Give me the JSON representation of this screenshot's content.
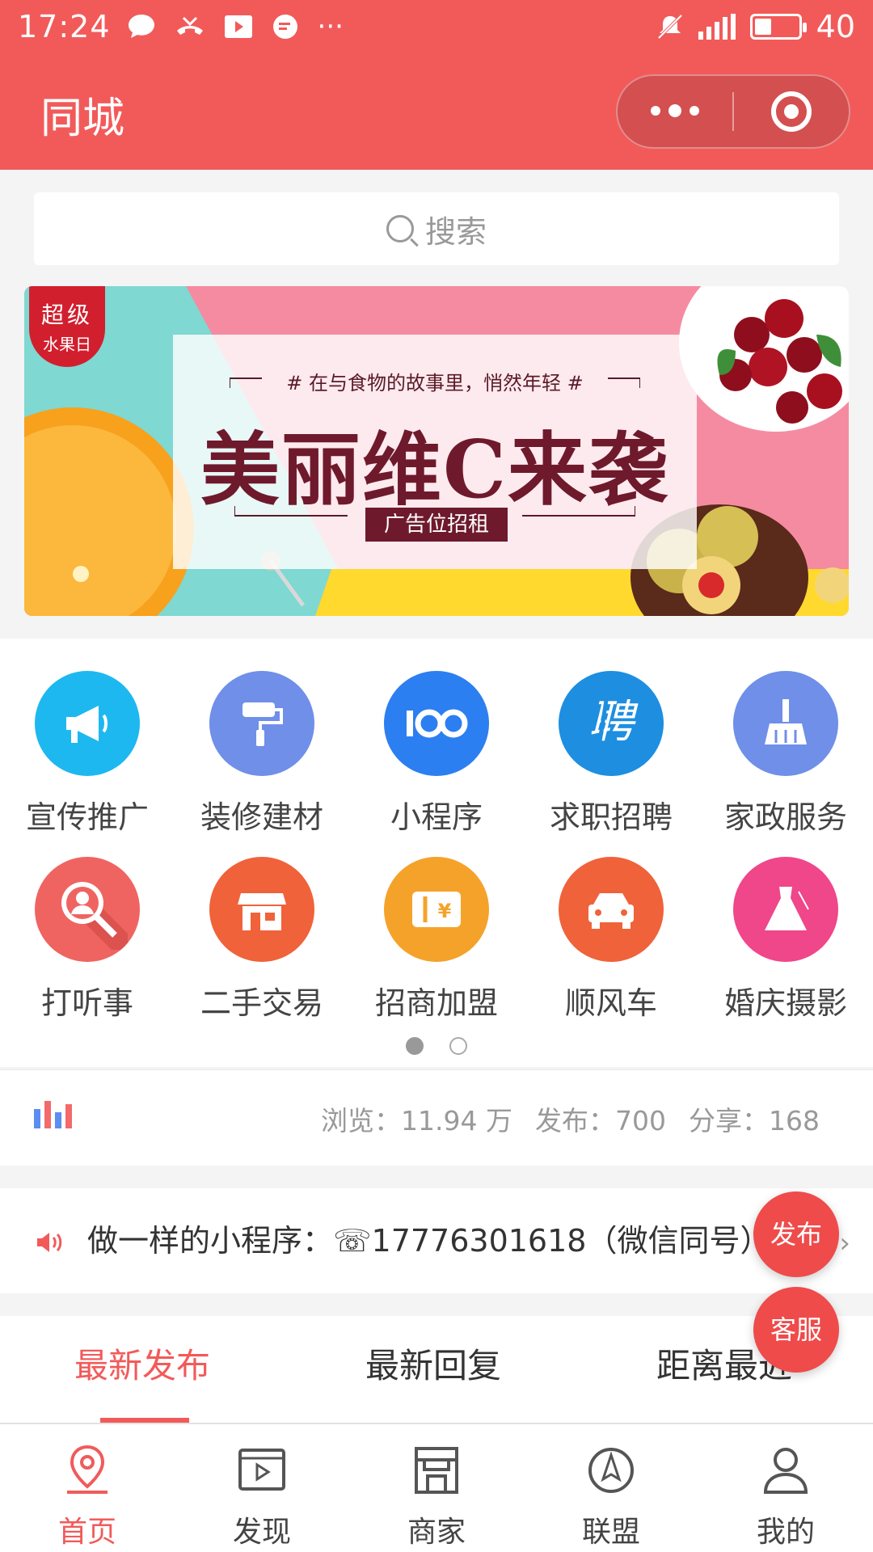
{
  "status_bar": {
    "time": "17:24",
    "battery": "40",
    "battery_level": 0.4,
    "network": "4G"
  },
  "header": {
    "title": "同城"
  },
  "search": {
    "placeholder": "搜索"
  },
  "banner": {
    "badge_line1": "超级",
    "badge_line2": "水果日",
    "subtitle": "# 在与食物的故事里，悄然年轻 #",
    "headline": "美丽维C来袭",
    "tag": "广告位招租"
  },
  "categories": [
    {
      "label": "宣传推广",
      "icon": "megaphone-icon",
      "color": "#1eb8f0"
    },
    {
      "label": "装修建材",
      "icon": "paint-roller-icon",
      "color": "#6f8fe8"
    },
    {
      "label": "小程序",
      "icon": "mini-program-icon",
      "color": "#2c7ff0"
    },
    {
      "label": "求职招聘",
      "icon": "recruit-icon",
      "color": "#1e8ee0"
    },
    {
      "label": "家政服务",
      "icon": "broom-icon",
      "color": "#6f8fe8"
    },
    {
      "label": "打听事",
      "icon": "magnifier-person-icon",
      "color": "#ef6461"
    },
    {
      "label": "二手交易",
      "icon": "shop-icon",
      "color": "#f0623a"
    },
    {
      "label": "招商加盟",
      "icon": "ticket-icon",
      "color": "#f5a22a"
    },
    {
      "label": "顺风车",
      "icon": "car-icon",
      "color": "#f0623a"
    },
    {
      "label": "婚庆摄影",
      "icon": "dress-icon",
      "color": "#f0468a"
    }
  ],
  "pager": {
    "pages": 2,
    "active": 0
  },
  "stats": {
    "views": "浏览：11.94 万",
    "posts": "发布：700",
    "shares": "分享：168"
  },
  "notice": {
    "text": "做一样的小程序：☏17776301618（微信同号）"
  },
  "tabs": [
    {
      "label": "最新发布",
      "active": true
    },
    {
      "label": "最新回复",
      "active": false
    },
    {
      "label": "距离最近",
      "active": false
    }
  ],
  "fabs": {
    "publish": "发布",
    "service": "客服"
  },
  "bottom_nav": [
    {
      "label": "首页",
      "icon": "location-pin-icon",
      "active": true
    },
    {
      "label": "发现",
      "icon": "video-play-icon",
      "active": false
    },
    {
      "label": "商家",
      "icon": "storefront-icon",
      "active": false
    },
    {
      "label": "联盟",
      "icon": "compass-icon",
      "active": false
    },
    {
      "label": "我的",
      "icon": "user-icon",
      "active": false
    }
  ],
  "colors": {
    "primary": "#f25a5a",
    "background": "#f4f4f4"
  }
}
